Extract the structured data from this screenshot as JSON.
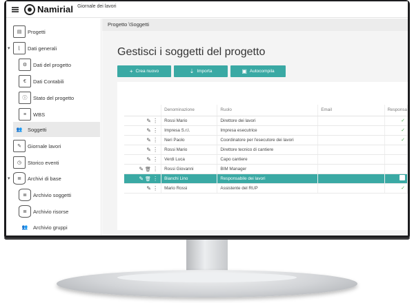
{
  "app": {
    "brand": "Namirial",
    "subtitle": "Giornale dei lavori"
  },
  "sidebar": {
    "items": [
      {
        "label": "Progetti",
        "icon": "projects-icon"
      },
      {
        "label": "Dati generali",
        "icon": "general-data-icon"
      },
      {
        "label": "Dati del progetto",
        "icon": "project-data-icon"
      },
      {
        "label": "Dati Contabili",
        "icon": "accounting-data-icon"
      },
      {
        "label": "Stato del progetto",
        "icon": "project-status-icon"
      },
      {
        "label": "WBS",
        "icon": "wbs-icon"
      },
      {
        "label": "Soggetti",
        "icon": "subjects-icon"
      },
      {
        "label": "Giornale lavori",
        "icon": "work-journal-icon"
      },
      {
        "label": "Storico eventi",
        "icon": "event-history-icon"
      },
      {
        "label": "Archivi di base",
        "icon": "base-archives-icon"
      },
      {
        "label": "Archivio soggetti",
        "icon": "subjects-archive-icon"
      },
      {
        "label": "Archivio risorse",
        "icon": "resources-archive-icon"
      },
      {
        "label": "Archivio gruppi",
        "icon": "groups-archive-icon"
      }
    ]
  },
  "main": {
    "breadcrumb": "Progetto \\Soggetti",
    "title": "Gestisci i soggetti del progetto",
    "buttons": {
      "new": "Crea nuovo",
      "import": "Importa",
      "autofill": "Autocompila"
    },
    "table": {
      "headers": [
        "Denominazione",
        "Ruolo",
        "Email",
        "Responsabile"
      ],
      "header_visible": [
        "Denominazione",
        "Ruolo",
        "Email",
        "Responsa"
      ],
      "rows": [
        {
          "name": "Rossi Mario",
          "role": "Direttore dei lavori",
          "email": "",
          "check": true,
          "selected": false,
          "delete": false
        },
        {
          "name": "Impresa S.r.l.",
          "role": "Impresa esecutrice",
          "email": "",
          "check": true,
          "selected": false,
          "delete": false
        },
        {
          "name": "Neri Paolo",
          "role": "Coordinatore per l'esecutore dei lavori",
          "email": "",
          "check": true,
          "selected": false,
          "delete": false
        },
        {
          "name": "Rossi Mario",
          "role": "Direttore tecnico di cantiere",
          "email": "",
          "check": false,
          "selected": false,
          "delete": false
        },
        {
          "name": "Verdi Luca",
          "role": "Capo cantiere",
          "email": "",
          "check": false,
          "selected": false,
          "delete": false
        },
        {
          "name": "Rossi Giovanni",
          "role": "BIM Manager",
          "email": "",
          "check": false,
          "selected": false,
          "delete": true
        },
        {
          "name": "Bianchi Lino",
          "role": "Responsabile dei lavori",
          "email": "",
          "check": true,
          "selected": true,
          "delete": true
        },
        {
          "name": "Mario Rossi",
          "role": "Assistente del RUP",
          "email": "",
          "check": true,
          "selected": false,
          "delete": false
        }
      ]
    }
  }
}
